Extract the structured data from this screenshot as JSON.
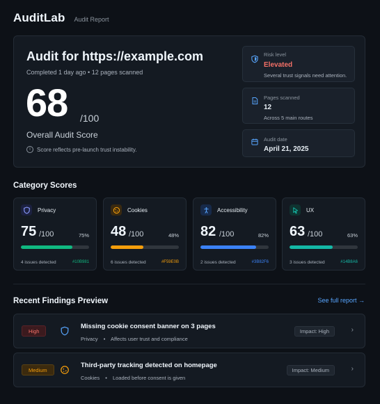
{
  "header": {
    "brand": "AuditLab",
    "crumb": "Audit Report"
  },
  "hero": {
    "title": "Audit for https://example.com",
    "subtitle": "Completed 1 day ago • 12 pages scanned",
    "score": "68",
    "score_max": "/100",
    "score_label": "Overall Audit Score",
    "note": "Score reflects pre-launch trust instability."
  },
  "side": {
    "risk": {
      "label": "Risk level",
      "value": "Elevated",
      "desc": "Several trust signals need attention.",
      "color": "#f47067"
    },
    "pages": {
      "label": "Pages scanned",
      "value": "12",
      "desc": "Across 5 main routes"
    },
    "date": {
      "label": "Audit date",
      "value": "April 21, 2025"
    }
  },
  "categories_title": "Category Scores",
  "categories": [
    {
      "name": "Privacy",
      "icon": "shield-icon",
      "score": "75",
      "max": "/100",
      "pct_label": "75%",
      "pct": 75,
      "issues": "4 issues detected",
      "hex": "#10B981",
      "color": "#10B981"
    },
    {
      "name": "Cookies",
      "icon": "cookie-icon",
      "score": "48",
      "max": "/100",
      "pct_label": "48%",
      "pct": 48,
      "issues": "6 issues detected",
      "hex": "#F59E0B",
      "color": "#F59E0B"
    },
    {
      "name": "Accessibility",
      "icon": "accessibility-icon",
      "score": "82",
      "max": "/100",
      "pct_label": "82%",
      "pct": 82,
      "issues": "2 issues detected",
      "hex": "#3B82F6",
      "color": "#3B82F6"
    },
    {
      "name": "UX",
      "icon": "cursor-icon",
      "score": "63",
      "max": "/100",
      "pct_label": "63%",
      "pct": 63,
      "issues": "3 issues detected",
      "hex": "#14B8A6",
      "color": "#14B8A6"
    }
  ],
  "findings_title": "Recent Findings Preview",
  "see_full": "See full report →",
  "findings": [
    {
      "severity": "High",
      "icon": "shield-icon",
      "title": "Missing cookie consent banner on 3 pages",
      "category": "Privacy",
      "detail": "Affects user trust and compliance",
      "impact": "Impact: High"
    },
    {
      "severity": "Medium",
      "icon": "cookie-icon",
      "title": "Third-party tracking detected on homepage",
      "category": "Cookies",
      "detail": "Loaded before consent is given",
      "impact": "Impact: Medium"
    }
  ]
}
